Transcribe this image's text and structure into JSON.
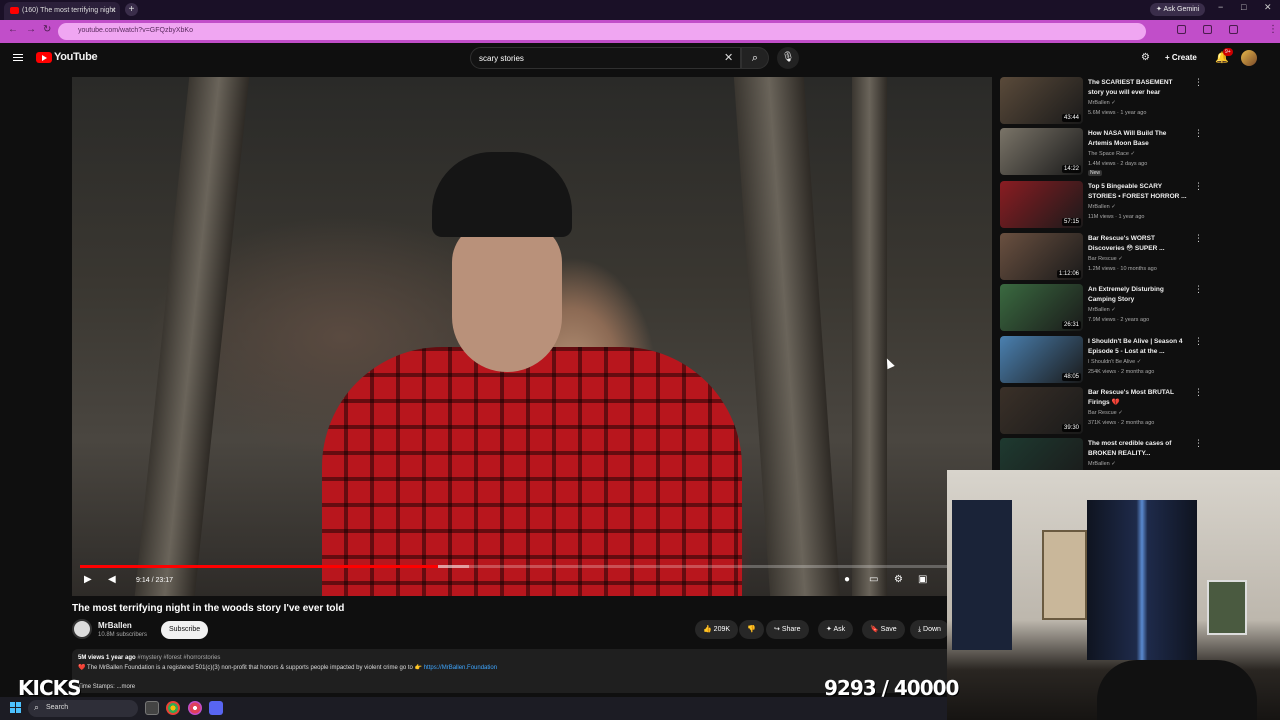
{
  "browser": {
    "tab_title": "(160) The most terrifying night",
    "new_tab": "+",
    "ask_gemini": "Ask Gemini",
    "url": "youtube.com/watch?v=GFQzbyXbKo",
    "win_min": "−",
    "win_max": "□",
    "win_close": "✕"
  },
  "youtube": {
    "logo_text": "YouTube",
    "search_value": "scary stories",
    "create_label": "Create",
    "notif_count": "9+"
  },
  "player": {
    "current_time": "9:14 / 23:17",
    "progress_fraction": 0.396,
    "buffered_fraction": 0.43
  },
  "video": {
    "title": "The most terrifying night in the woods story I've ever told",
    "channel": "MrBallen",
    "subscribers": "10.8M subscribers",
    "subscribe_label": "Subscribe",
    "likes": "209K",
    "share_label": "Share",
    "ask_label": "Ask",
    "save_label": "Save",
    "download_label": "Down",
    "views_date": "5M views  1 year ago",
    "hashtags": "#mystery #forest #horrorstories",
    "desc_line": "❤️ The MrBallen Foundation is a registered 501(c)(3) non-profit that honors & supports people impacted by violent crime go to 👉",
    "desc_link": "https://MrBallen.Foundation",
    "timestamps": "Time Stamps:",
    "more": "...more"
  },
  "overlay": {
    "kicks": "KICKS",
    "counter": "9293 / 40000"
  },
  "recommendations": [
    {
      "title": "The SCARIEST BASEMENT story you will ever hear",
      "channel": "MrBallen",
      "meta": "5.6M views · 1 year ago",
      "duration": "43:44",
      "thumb": "#5a4a3a",
      "new": ""
    },
    {
      "title": "How NASA Will Build The Artemis Moon Base",
      "channel": "The Space Race",
      "meta": "1.4M views · 2 days ago",
      "duration": "14:22",
      "thumb": "#7a7468",
      "new": "New"
    },
    {
      "title": "Top 5 Bingeable SCARY STORIES • FOREST HORROR ...",
      "channel": "MrBallen",
      "meta": "11M views · 1 year ago",
      "duration": "57:15",
      "thumb": "#8a1c22",
      "new": ""
    },
    {
      "title": "Bar Rescue's WORST Discoveries 😳 SUPER ...",
      "channel": "Bar Rescue",
      "meta": "1.2M views · 10 months ago",
      "duration": "1:12:06",
      "thumb": "#6a5040",
      "new": ""
    },
    {
      "title": "An Extremely Disturbing Camping Story",
      "channel": "MrBallen",
      "meta": "7.9M views · 2 years ago",
      "duration": "26:31",
      "thumb": "#3a6a40",
      "new": ""
    },
    {
      "title": "I Shouldn't Be Alive | Season 4 Episode 5 - Lost at the ...",
      "channel": "I Shouldn't Be Alive",
      "meta": "254K views · 2 months ago",
      "duration": "48:05",
      "thumb": "#4a80b0",
      "new": ""
    },
    {
      "title": "Bar Rescue's Most BRUTAL Firings 💔",
      "channel": "Bar Rescue",
      "meta": "371K views · 2 months ago",
      "duration": "39:30",
      "thumb": "#3a3028",
      "new": ""
    },
    {
      "title": "The most credible cases of BROKEN REALITY...",
      "channel": "MrBallen",
      "meta": "",
      "duration": "",
      "thumb": "#1e3a30",
      "new": ""
    }
  ],
  "taskbar": {
    "search_label": "Search"
  }
}
